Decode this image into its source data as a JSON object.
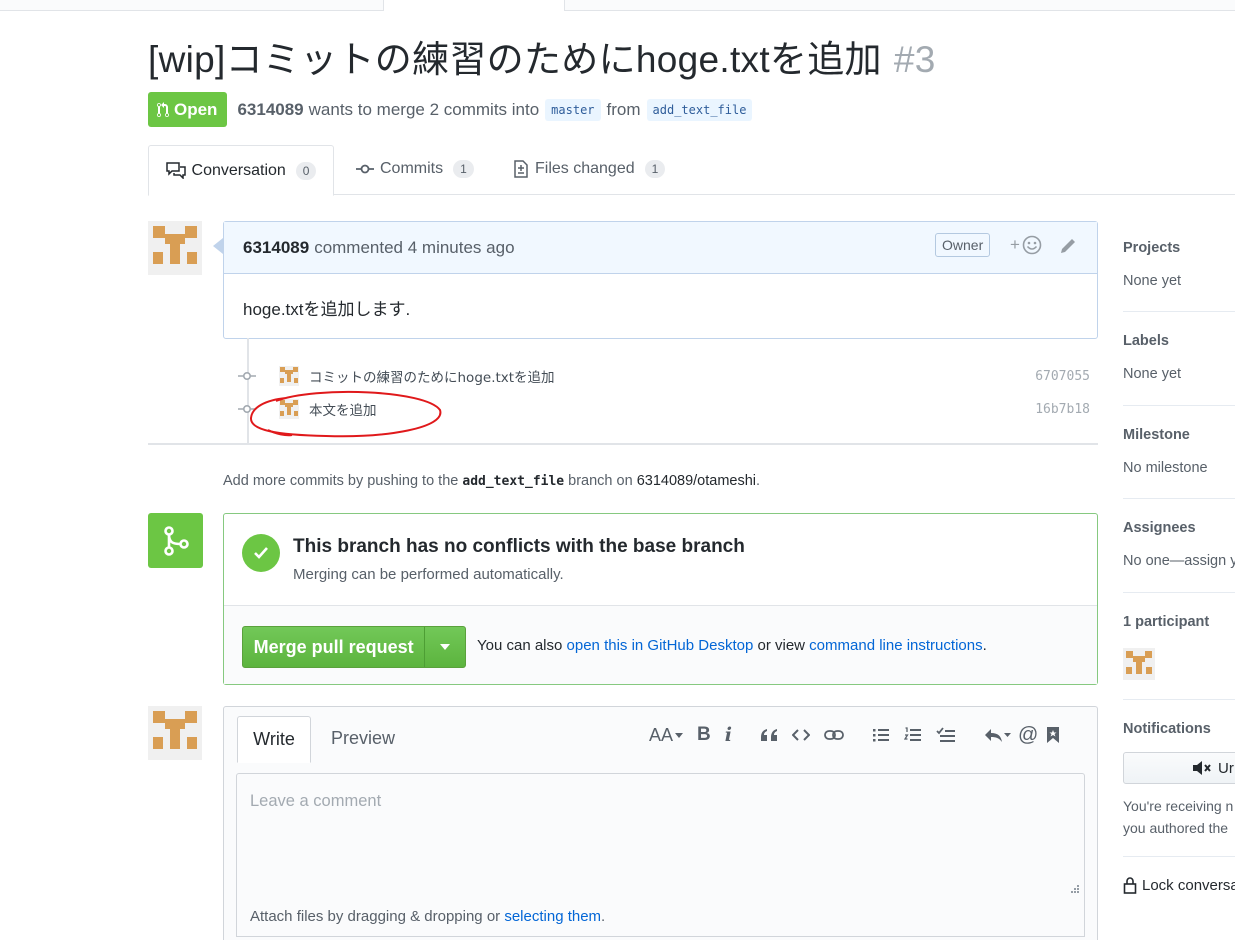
{
  "pr": {
    "title": "[wip]コミットの練習のためにhoge.txtを追加",
    "number": "#3",
    "state": "Open",
    "author": "6314089",
    "merge_text": "wants to merge 2 commits into",
    "base_branch": "master",
    "from_text": "from",
    "head_branch": "add_text_file"
  },
  "tabs": [
    {
      "label": "Conversation",
      "count": "0"
    },
    {
      "label": "Commits",
      "count": "1"
    },
    {
      "label": "Files changed",
      "count": "1"
    }
  ],
  "comment": {
    "author": "6314089",
    "action": "commented 4 minutes ago",
    "role": "Owner",
    "reaction": "+",
    "body": "hoge.txtを追加します."
  },
  "commits": [
    {
      "message": "コミットの練習のためにhoge.txtを追加",
      "sha": "6707055"
    },
    {
      "message": "本文を追加",
      "sha": "16b7b18"
    }
  ],
  "add_more": {
    "prefix": "Add more commits by pushing to the",
    "branch": "add_text_file",
    "middle": "branch on",
    "repo": "6314089/otameshi",
    "suffix": "."
  },
  "merge": {
    "title": "This branch has no conflicts with the base branch",
    "subtitle": "Merging can be performed automatically.",
    "button": "Merge pull request",
    "also_prefix": "You can also",
    "desktop_link": "open this in GitHub Desktop",
    "or_view": "or view",
    "cli_link": "command line instructions",
    "period": "."
  },
  "editor": {
    "write_tab": "Write",
    "preview_tab": "Preview",
    "placeholder": "Leave a comment",
    "attach_prefix": "Attach files by dragging & dropping or",
    "attach_link": "selecting them",
    "attach_suffix": ".",
    "toolbar_text": {
      "heading": "AA",
      "bold": "B",
      "italic": "i",
      "mention": "@"
    }
  },
  "sidebar": {
    "projects": {
      "label": "Projects",
      "value": "None yet"
    },
    "labels": {
      "label": "Labels",
      "value": "None yet"
    },
    "milestone": {
      "label": "Milestone",
      "value": "No milestone"
    },
    "assignees": {
      "label": "Assignees",
      "value": "No one—assign y"
    },
    "participants": {
      "label": "1 participant"
    },
    "notifications": {
      "label": "Notifications",
      "button": "Ur",
      "note_line1": "You're receiving n",
      "note_line2": "you authored the"
    },
    "lock": "Lock conversa"
  },
  "colors": {
    "open_green": "#6cc644",
    "link_blue": "#0366d6",
    "annotation_red": "#e0191b",
    "avatar_orange": "#d99e54"
  }
}
